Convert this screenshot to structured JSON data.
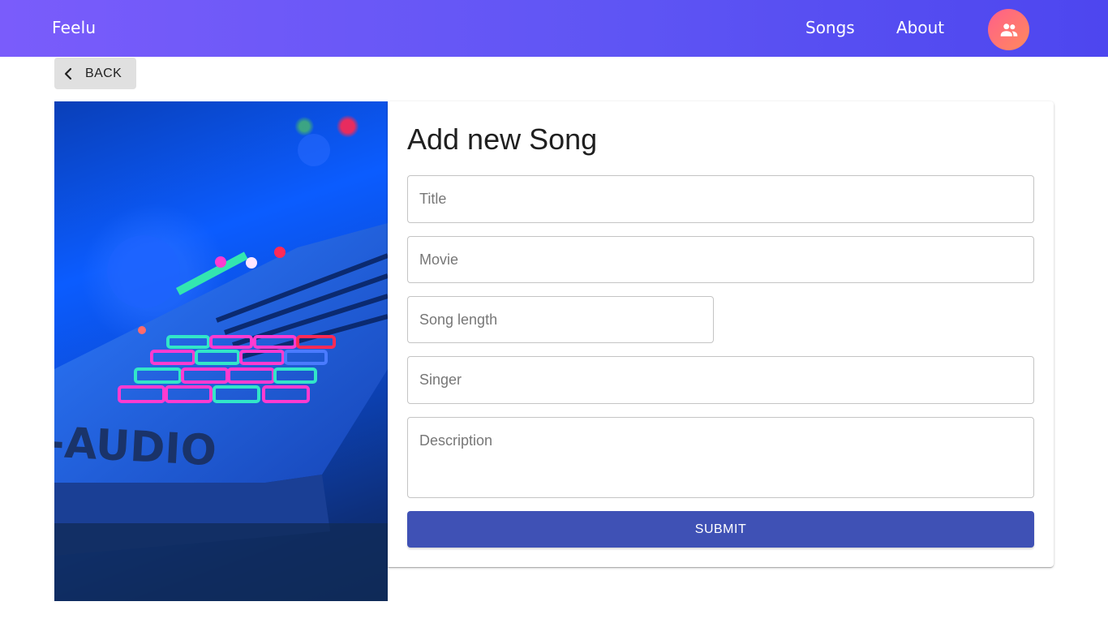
{
  "appbar": {
    "brand": "Feelu",
    "nav": [
      "Songs",
      "About"
    ],
    "avatar_icon": "people-icon",
    "gradient": [
      "#7a5cfb",
      "#4d46ef"
    ]
  },
  "back": {
    "label": "BACK",
    "icon": "chevron-left-icon"
  },
  "hero": {
    "alt": "MIDI pad controller keyboard lit in blue with pink and cyan pads",
    "visible_text": "-AUDIO"
  },
  "form": {
    "title": "Add new Song",
    "fields": {
      "title": {
        "placeholder": "Title",
        "value": ""
      },
      "movie": {
        "placeholder": "Movie",
        "value": ""
      },
      "song_length": {
        "placeholder": "Song length",
        "value": ""
      },
      "singer": {
        "placeholder": "Singer",
        "value": ""
      },
      "description": {
        "placeholder": "Description",
        "value": ""
      }
    },
    "submit_label": "SUBMIT",
    "accent": "#3f51b5"
  }
}
